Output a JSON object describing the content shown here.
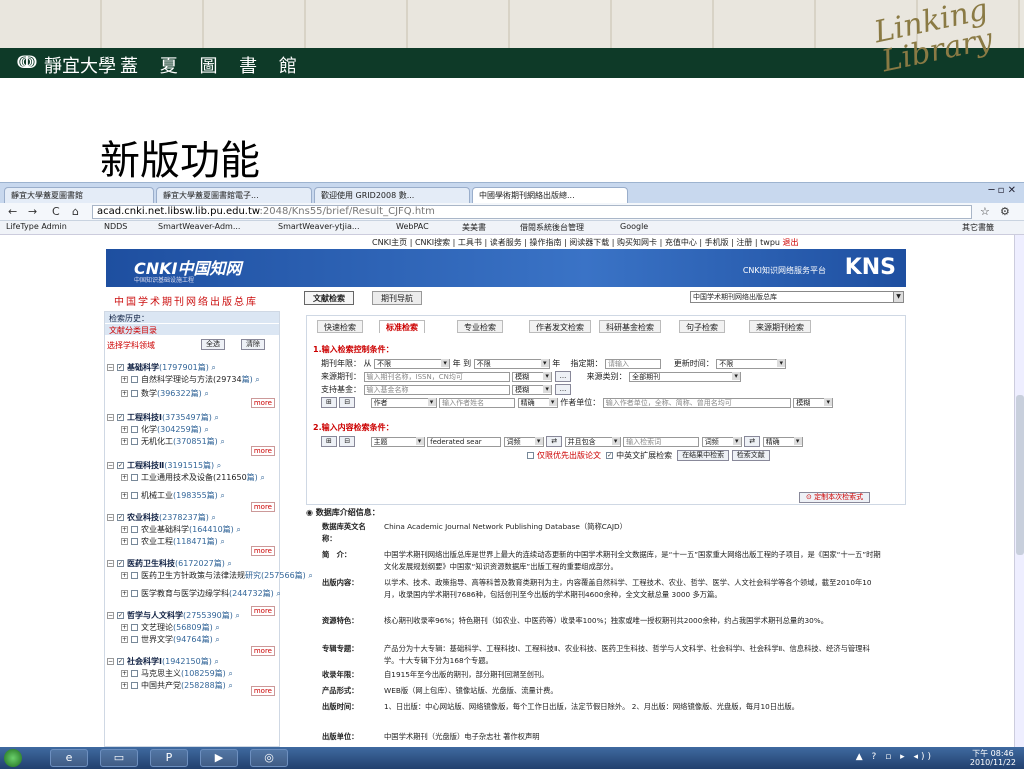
{
  "banner": {
    "logo_glyph": "ↈ",
    "university": "靜宜大學",
    "library": "蓋 夏 圖 書 館",
    "brand_logo": "Linking Library"
  },
  "slide": {
    "title": "新版功能"
  },
  "browser": {
    "tabs": [
      "靜宜大學蓋夏圖書館",
      "靜宜大學蓋夏圖書館電子...",
      "歡迎使用 GRID2008 數...",
      "中國學術期刊網絡出版總..."
    ],
    "window_controls": "─ ▫ ✕",
    "nav_back": "←",
    "nav_forward": "→",
    "nav_reload": "C",
    "nav_home": "⌂",
    "url_host": "acad.cnki.net.libsw.lib.pu.edu.tw",
    "url_path": ":2048/Kns55/brief/Result_CJFQ.htm",
    "bookmarks": [
      "LifeType Admin",
      "NDDS",
      "SmartWeaver-Adm...",
      "SmartWeaver-ytjia...",
      "WebPAC",
      "美美書",
      "借閱系統後台管理",
      "Google",
      "其它書籤"
    ]
  },
  "page": {
    "topnav": "CNKI主页 | CNKI搜索 | 工具书 | 读者服务 | 操作指南 | 阅读器下载 | 购买知网卡 | 充值中心 | 手机版 | 注册 |",
    "topnav_user": "twpu",
    "topnav_exit": "退出",
    "cnki_logo": "CNKI中国知网",
    "cnki_logo_sub": "中国知识基础设施工程",
    "kns_sub": "CNKI知识网络服务平台",
    "kns": "KNS",
    "db_title": "中国学术期刊网络出版总库",
    "tab_doc": "文献检索",
    "tab_journal": "期刊导航",
    "db_select": "中国学术期刊网络出版总库"
  },
  "sidebar": {
    "history": "检索历史：",
    "catalog": "文献分类目录",
    "select_label": "选择学科领域",
    "btn_all": "全选",
    "btn_clear": "清除",
    "more": "more",
    "items": [
      {
        "type": "cat",
        "label": "基础科学",
        "count": "(1797901篇)"
      },
      {
        "type": "sub",
        "label": "自然科学理论与方法(29734",
        "count": "篇)"
      },
      {
        "type": "sub",
        "label": "数学",
        "count": "(396322篇)"
      },
      {
        "type": "cat",
        "label": "工程科技Ⅰ",
        "count": "(3735497篇)"
      },
      {
        "type": "sub",
        "label": "化学",
        "count": "(304259篇)"
      },
      {
        "type": "sub",
        "label": "无机化工",
        "count": "(370851篇)"
      },
      {
        "type": "cat",
        "label": "工程科技Ⅱ",
        "count": "(3191515篇)"
      },
      {
        "type": "sub",
        "label": "工业通用技术及设备(211650",
        "count": "篇)"
      },
      {
        "type": "sub",
        "label": "机械工业",
        "count": "(198355篇)"
      },
      {
        "type": "cat",
        "label": "农业科技",
        "count": "(2378237篇)"
      },
      {
        "type": "sub",
        "label": "农业基础科学",
        "count": "(164410篇)"
      },
      {
        "type": "sub",
        "label": "农业工程",
        "count": "(118471篇)"
      },
      {
        "type": "cat",
        "label": "医药卫生科技",
        "count": "(6172027篇)"
      },
      {
        "type": "sub",
        "label": "医药卫生方针政策与法律法规",
        "count": "研究(257566篇)"
      },
      {
        "type": "sub",
        "label": "医学教育与医学边缘学科",
        "count": "(244732篇)"
      },
      {
        "type": "cat",
        "label": "哲学与人文科学",
        "count": "(2755390篇)"
      },
      {
        "type": "sub",
        "label": "文艺理论",
        "count": "(56809篇)"
      },
      {
        "type": "sub",
        "label": "世界文学",
        "count": "(94764篇)"
      },
      {
        "type": "cat",
        "label": "社会科学Ⅰ",
        "count": "(1942150篇)"
      },
      {
        "type": "sub",
        "label": "马克思主义",
        "count": "(108259篇)"
      },
      {
        "type": "sub",
        "label": "中国共产党",
        "count": "(258288篇)"
      }
    ]
  },
  "search": {
    "tabs": [
      "快速检索",
      "标准检索",
      "专业检索",
      "作者发文检索",
      "科研基金检索",
      "句子检索",
      "来源期刊检索"
    ],
    "sec1": "1.输入检索控制条件：",
    "sec2": "2.输入内容检索条件：",
    "pub_year": "期刊年限：",
    "from": "从",
    "to": "年 到",
    "year_unit": "年",
    "unlimited": "不限",
    "designated": "指定期：",
    "please_input": "请输入",
    "update_time": "更新时间：",
    "source_journal": "来源期刊：",
    "source_ph": "输入期刊名称，ISSN，CN均可",
    "fuzzy": "模糊",
    "dots": "...",
    "source_type": "来源类别：",
    "all_journals": "全部期刊",
    "fund": "支持基金：",
    "fund_ph": "输入基金名称",
    "author": "作者",
    "author_ph": "输入作者姓名",
    "exact": "精确",
    "author_unit": "作者单位：",
    "unit_ph": "输入作者单位，全称、简称、曾用名均可",
    "subject": "主题",
    "term": "federated sear",
    "word_freq": "词频",
    "and_contains": "并且包含",
    "kw_ph": "输入检索词",
    "only_first": "仅限优先出版论文",
    "cn_en": "中英文扩展检索",
    "in_result": "在结果中检索",
    "search_btn": "检索文献",
    "customize": "定制本次检索式"
  },
  "info": {
    "heading": "数据库介绍信息：",
    "rows": [
      {
        "k": "数据库英文名称：",
        "v": "China Academic Journal Network Publishing Database（简称CAJD）"
      },
      {
        "k": "简　介：",
        "v": "中国学术期刊网络出版总库是世界上最大的连续动态更新的中国学术期刊全文数据库，是“十一五”国家重大网络出版工程的子项目，是《国家“十一五”时期文化发展规划纲要》中国家“知识资源数据库”出版工程的重要组成部分。"
      },
      {
        "k": "出版内容：",
        "v": "以学术、技术、政策指导、高等科普及教育类期刊为主，内容覆盖自然科学、工程技术、农业、哲学、医学、人文社会科学等各个领域，截至2010年10月，收录国内学术期刊7686种，包括创刊至今出版的学术期刊4600余种，全文文献总量 3000 多万篇。"
      },
      {
        "k": "资源特色：",
        "v": "核心期刊收录率96%；特色期刊（如农业、中医药等）收录率100%；独家或唯一授权期刊共2000余种，约占我国学术期刊总量的30%。"
      },
      {
        "k": "专辑专题：",
        "v": "产品分为十大专辑：基础科学、工程科技Ⅰ、工程科技Ⅱ、农业科技、医药卫生科技、哲学与人文科学、社会科学Ⅰ、社会科学Ⅱ、信息科技、经济与管理科学。十大专辑下分为168个专题。"
      },
      {
        "k": "收录年限：",
        "v": "自1915年至今出版的期刊，部分期刊回溯至创刊。"
      },
      {
        "k": "产品形式：",
        "v": "WEB版（网上包库）、镜像站版、光盘版、流量计费。"
      },
      {
        "k": "出版时间：",
        "v": "1、日出版：中心网站版、网络镜像版，每个工作日出版，法定节假日除外。 2、月出版：网络镜像版、光盘版，每月10日出版。"
      },
      {
        "k": "出版单位：",
        "v": "中国学术期刊（光盘版）电子杂志社 著作权声明"
      }
    ]
  },
  "taskbar": {
    "time": "下午 08:46",
    "date": "2010/11/22",
    "tray": "▲ ? ▫ ▸ ◂))"
  }
}
